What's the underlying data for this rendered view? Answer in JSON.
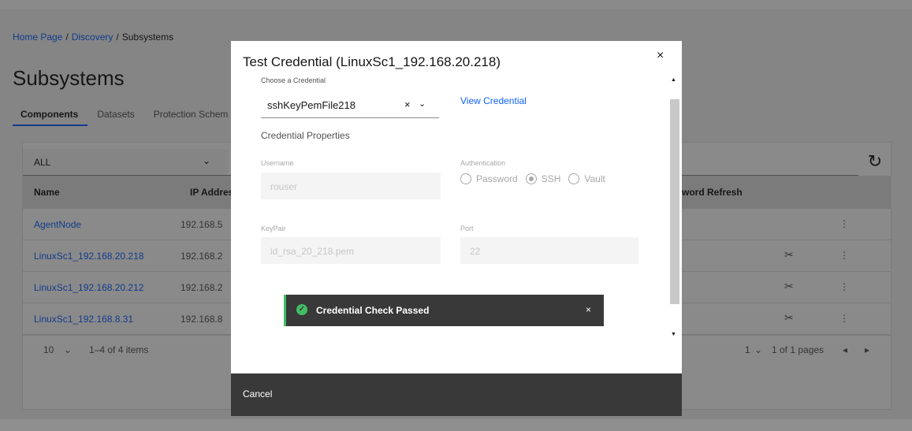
{
  "breadcrumb": {
    "home": "Home Page",
    "discovery": "Discovery",
    "current": "Subsystems",
    "sep": "/"
  },
  "page": {
    "title": "Subsystems"
  },
  "tabs": [
    "Components",
    "Datasets",
    "Protection Schem"
  ],
  "filter": {
    "value": "ALL",
    "chevron": "⌄"
  },
  "refresh_icon": "↻",
  "table": {
    "headers": {
      "name": "Name",
      "ip": "IP Addres",
      "pwd": "word Refresh"
    },
    "rows": [
      {
        "name": "AgentNode",
        "ip": "192.168.5",
        "tool": "",
        "kebab": "⋮"
      },
      {
        "name": "LinuxSc1_192.168.20.218",
        "ip": "192.168.2",
        "tool": "✂",
        "kebab": "⋮"
      },
      {
        "name": "LinuxSc1_192.168.20.212",
        "ip": "192.168.2",
        "tool": "✂",
        "kebab": "⋮"
      },
      {
        "name": "LinuxSc1_192.168.8.31",
        "ip": "192.168.8",
        "tool": "✂",
        "kebab": "⋮"
      }
    ]
  },
  "pagination": {
    "per_page": "10",
    "per_page_chev": "⌄",
    "items": "1–4 of 4 items",
    "page": "1",
    "page_chev": "⌄",
    "pages": "1 of 1 pages",
    "prev": "◂",
    "next": "▸"
  },
  "modal": {
    "title": "Test Credential (LinuxSc1_192.168.20.218)",
    "close": "×",
    "choose_label": "Choose a Credential",
    "credential": "sshKeyPemFile218",
    "clear": "×",
    "chevron": "⌄",
    "view_credential": "View Credential",
    "section": "Credential Properties",
    "username_label": "Username",
    "username": "rouser",
    "auth_label": "Authentication",
    "auth_options": [
      "Password",
      "SSH",
      "Vault"
    ],
    "keypair_label": "KeyPair",
    "keypair": "id_rsa_20_218.pem",
    "port_label": "Port",
    "port": "22",
    "scroll_up": "▲",
    "scroll_down": "▼",
    "cancel": "Cancel"
  },
  "toast": {
    "icon": "✓",
    "message": "Credential Check Passed",
    "close": "×"
  },
  "colors": {
    "link": "#0f62fe",
    "success": "#42be65",
    "dark": "#393939"
  }
}
